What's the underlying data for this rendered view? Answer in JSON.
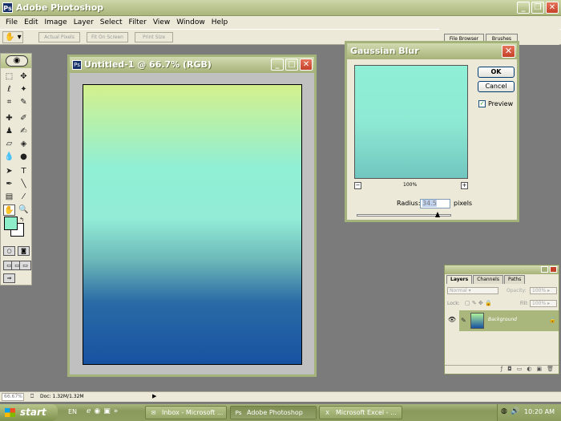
{
  "app": {
    "title": "Adobe Photoshop",
    "icon": "photoshop-icon"
  },
  "menu": [
    "File",
    "Edit",
    "Image",
    "Layer",
    "Select",
    "Filter",
    "View",
    "Window",
    "Help"
  ],
  "options": {
    "actual_pixels": "Actual Pixels",
    "fit_on_screen": "Fit On Screen",
    "print_size": "Print Size"
  },
  "palette_well": {
    "file_browser": "File Browser",
    "brushes": "Brushes"
  },
  "document": {
    "title": "Untitled-1 @ 66.7% (RGB)"
  },
  "toolbox": {
    "foreground_color": "#8deec9",
    "background_color": "#ffffff"
  },
  "dialog": {
    "title": "Gaussian Blur",
    "ok": "OK",
    "cancel": "Cancel",
    "preview_label": "Preview",
    "preview_checked": true,
    "zoom": "100%",
    "radius_label": "Radius:",
    "radius_value": "34.5",
    "units": "pixels"
  },
  "layers": {
    "tabs": [
      "Layers",
      "Channels",
      "Paths"
    ],
    "blend_mode": "Normal",
    "opacity_label": "Opacity:",
    "opacity_value": "100%",
    "lock_label": "Lock:",
    "fill_label": "Fill:",
    "fill_value": "100%",
    "layer_name": "Background"
  },
  "status": {
    "zoom": "66.67%",
    "doc": "Doc: 1.32M/1.32M"
  },
  "taskbar": {
    "start": "start",
    "lang": "EN",
    "items": [
      "Inbox - Microsoft ...",
      "Adobe Photoshop",
      "Microsoft Excel - ..."
    ],
    "clock": "10:20 AM"
  },
  "colors": {
    "chrome": "#a9b67c",
    "menu_bg": "#ece9d8",
    "workspace": "#7b7b7b"
  }
}
